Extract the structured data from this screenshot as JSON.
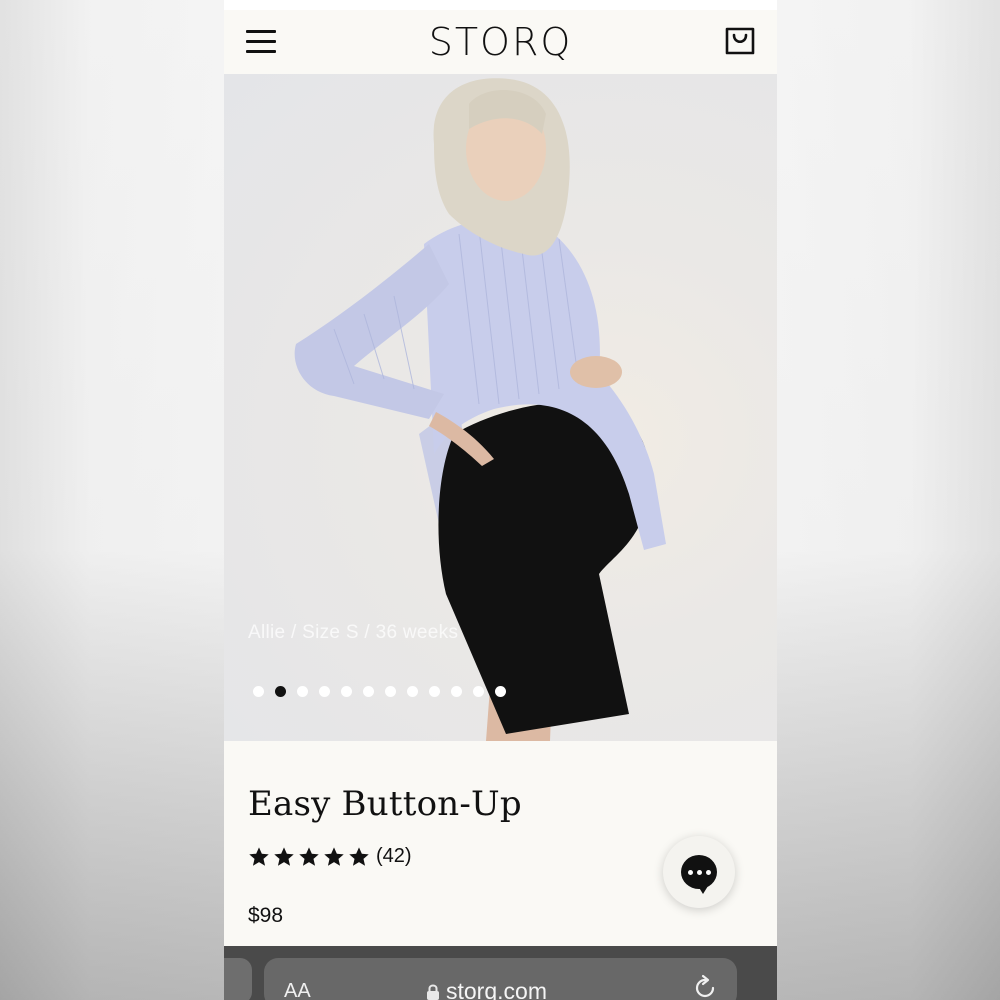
{
  "header": {
    "brand": "STORQ"
  },
  "hero": {
    "caption": "Allie / Size S / 36 weeks",
    "slide_count": 12,
    "active_slide": 2
  },
  "product": {
    "title": "Easy Button-Up",
    "rating_stars": 5,
    "review_count": "(42)",
    "price": "$98"
  },
  "browser": {
    "text_size_label": "AA",
    "url": "storq.com"
  },
  "icons": {
    "menu": "hamburger-menu-icon",
    "bag": "shopping-bag-icon",
    "star": "star-icon",
    "chat": "chat-bubble-icon",
    "lock": "lock-icon",
    "reload": "reload-icon"
  },
  "colors": {
    "page_bg": "#faf9f5",
    "text": "#111111",
    "active_dot": "#111111",
    "inactive_dot": "#ffffff"
  }
}
